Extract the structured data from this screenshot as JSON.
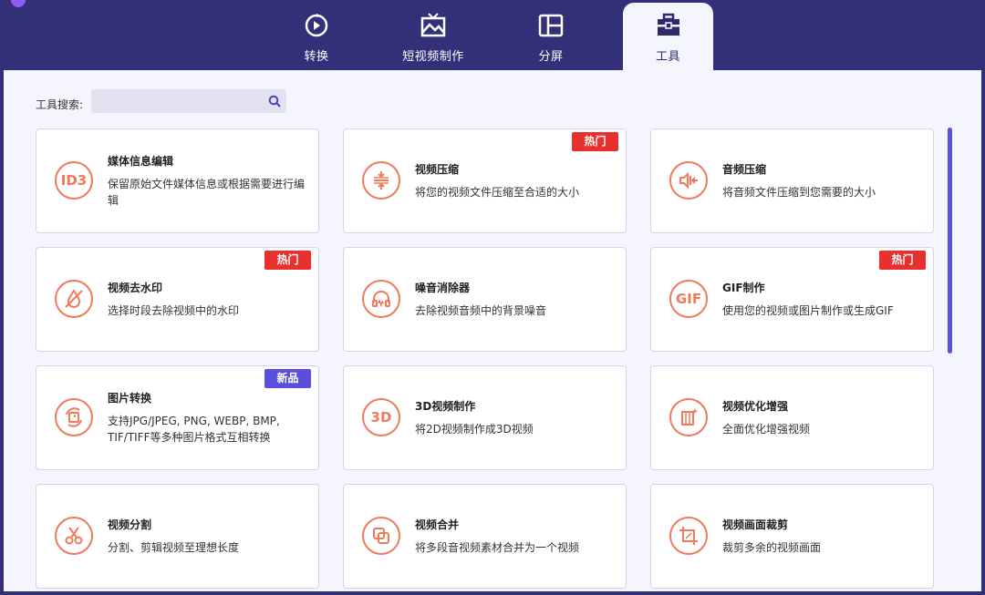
{
  "nav": {
    "tabs": [
      {
        "label": "转换",
        "icon": "convert-icon"
      },
      {
        "label": "短视频制作",
        "icon": "image-tv-icon"
      },
      {
        "label": "分屏",
        "icon": "split-screen-icon"
      },
      {
        "label": "工具",
        "icon": "toolbox-icon",
        "active": true
      }
    ]
  },
  "search": {
    "label": "工具搜索:",
    "placeholder": "",
    "value": ""
  },
  "colors": {
    "accent": "#f07a5a",
    "brand": "#33307a",
    "hot": "#e8302f",
    "new": "#5a4fdc"
  },
  "tools": [
    {
      "title": "媒体信息编辑",
      "desc": "保留原始文件媒体信息或根据需要进行编辑",
      "icon": "id3-icon",
      "badge": ""
    },
    {
      "title": "视频压缩",
      "desc": "将您的视频文件压缩至合适的大小",
      "icon": "compress-icon",
      "badge": "热门"
    },
    {
      "title": "音频压缩",
      "desc": "将音频文件压缩到您需要的大小",
      "icon": "audio-compress-icon",
      "badge": ""
    },
    {
      "title": "视频去水印",
      "desc": "选择时段去除视频中的水印",
      "icon": "no-watermark-icon",
      "badge": "热门"
    },
    {
      "title": "噪音消除器",
      "desc": "去除视频音频中的背景噪音",
      "icon": "headphones-icon",
      "badge": ""
    },
    {
      "title": "GIF制作",
      "desc": "使用您的视频或图片制作或生成GIF",
      "icon": "gif-icon",
      "badge": "热门"
    },
    {
      "title": "图片转换",
      "desc": "支持JPG/JPEG, PNG, WEBP, BMP, TIF/TIFF等多种图片格式互相转换",
      "icon": "image-convert-icon",
      "badge": "新品"
    },
    {
      "title": "3D视频制作",
      "desc": "将2D视频制作成3D视频",
      "icon": "3d-icon",
      "badge": ""
    },
    {
      "title": "视频优化增强",
      "desc": "全面优化增强视频",
      "icon": "enhance-icon",
      "badge": ""
    },
    {
      "title": "视频分割",
      "desc": "分割、剪辑视频至理想长度",
      "icon": "scissors-icon",
      "badge": ""
    },
    {
      "title": "视频合并",
      "desc": "将多段音视频素材合并为一个视频",
      "icon": "merge-icon",
      "badge": ""
    },
    {
      "title": "视频画面裁剪",
      "desc": "裁剪多余的视频画面",
      "icon": "crop-icon",
      "badge": ""
    }
  ]
}
